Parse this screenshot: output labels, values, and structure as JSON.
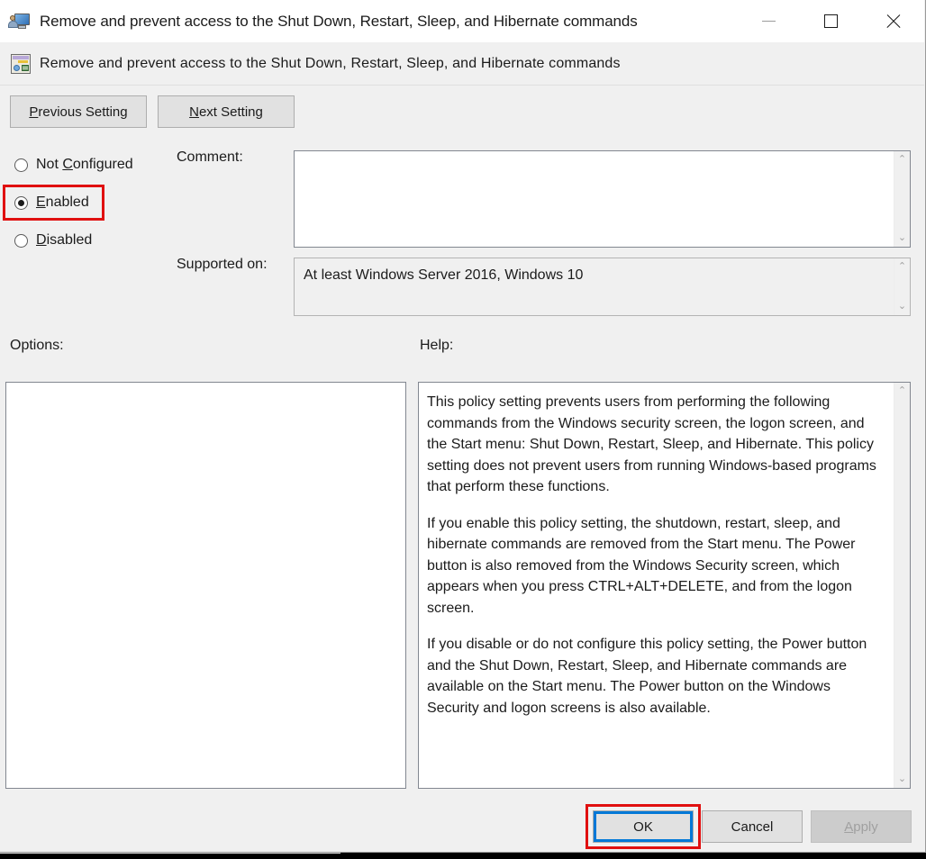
{
  "window": {
    "title": "Remove and prevent access to the Shut Down, Restart, Sleep, and Hibernate commands",
    "header_title": "Remove and prevent access to the Shut Down, Restart, Sleep, and Hibernate commands",
    "icon": "policy-setting-icon",
    "controls": {
      "minimize": "minimize-icon",
      "maximize": "maximize-icon",
      "close": "close-icon"
    }
  },
  "nav": {
    "previous_label": "Previous Setting",
    "previous_accel": "P",
    "next_label": "Next Setting",
    "next_accel": "N"
  },
  "state": {
    "selected": "Enabled",
    "options": [
      {
        "id": "not-configured",
        "label": "Not Configured",
        "accel_index": 4,
        "checked": false
      },
      {
        "id": "enabled",
        "label": "Enabled",
        "accel_index": 0,
        "checked": true
      },
      {
        "id": "disabled",
        "label": "Disabled",
        "accel_index": 0,
        "checked": false
      }
    ]
  },
  "fields": {
    "comment_label": "Comment:",
    "comment_value": "",
    "supported_label": "Supported on:",
    "supported_value": "At least Windows Server 2016, Windows 10"
  },
  "panels": {
    "options_label": "Options:",
    "options_content": "",
    "help_label": "Help:",
    "help_paragraphs": [
      "This policy setting prevents users from performing the following commands from the Windows security screen, the logon screen, and the Start menu: Shut Down, Restart, Sleep, and Hibernate. This policy setting does not prevent users from running Windows-based programs that perform these functions.",
      "If you enable this policy setting, the shutdown, restart, sleep, and hibernate commands are removed from the Start menu. The Power button is also removed from the Windows Security screen, which appears when you press CTRL+ALT+DELETE, and from the logon screen.",
      "If you disable or do not configure this policy setting, the Power button and the Shut Down, Restart, Sleep, and Hibernate commands are available on the Start menu. The Power button on the Windows Security and logon screens is also available."
    ]
  },
  "scrollbars": {
    "up_arrow": "⌃",
    "down_arrow": "⌄"
  },
  "footer": {
    "ok_label": "OK",
    "cancel_label": "Cancel",
    "apply_label": "Apply",
    "apply_accel": "A",
    "apply_disabled": true
  },
  "annotations": {
    "highlight_color": "#e01010",
    "focus_color": "#0078d7",
    "targets": [
      "enabled-radio",
      "ok-button"
    ]
  }
}
